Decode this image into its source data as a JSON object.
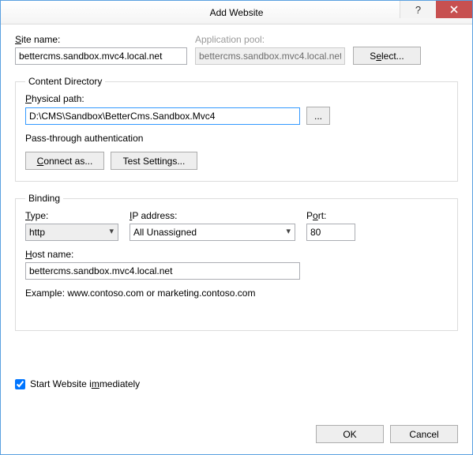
{
  "window": {
    "title": "Add Website"
  },
  "siteName": {
    "label": "Site name:",
    "value": "bettercms.sandbox.mvc4.local.net"
  },
  "appPool": {
    "label": "Application pool:",
    "value": "bettercms.sandbox.mvc4.local.net",
    "selectBtn": "Select..."
  },
  "contentDir": {
    "legend": "Content Directory",
    "physPathLabel": "Physical path:",
    "physPath": "D:\\CMS\\Sandbox\\BetterCms.Sandbox.Mvc4",
    "browseBtn": "...",
    "passThrough": "Pass-through authentication",
    "connectAs": "Connect as...",
    "testSettings": "Test Settings..."
  },
  "binding": {
    "legend": "Binding",
    "typeLabel": "Type:",
    "type": "http",
    "ipLabel": "IP address:",
    "ip": "All Unassigned",
    "portLabel": "Port:",
    "port": "80",
    "hostLabel": "Host name:",
    "host": "bettercms.sandbox.mvc4.local.net",
    "example": "Example: www.contoso.com or marketing.contoso.com"
  },
  "startImmediately": {
    "label": "Start Website immediately",
    "checked": true
  },
  "buttons": {
    "ok": "OK",
    "cancel": "Cancel"
  }
}
